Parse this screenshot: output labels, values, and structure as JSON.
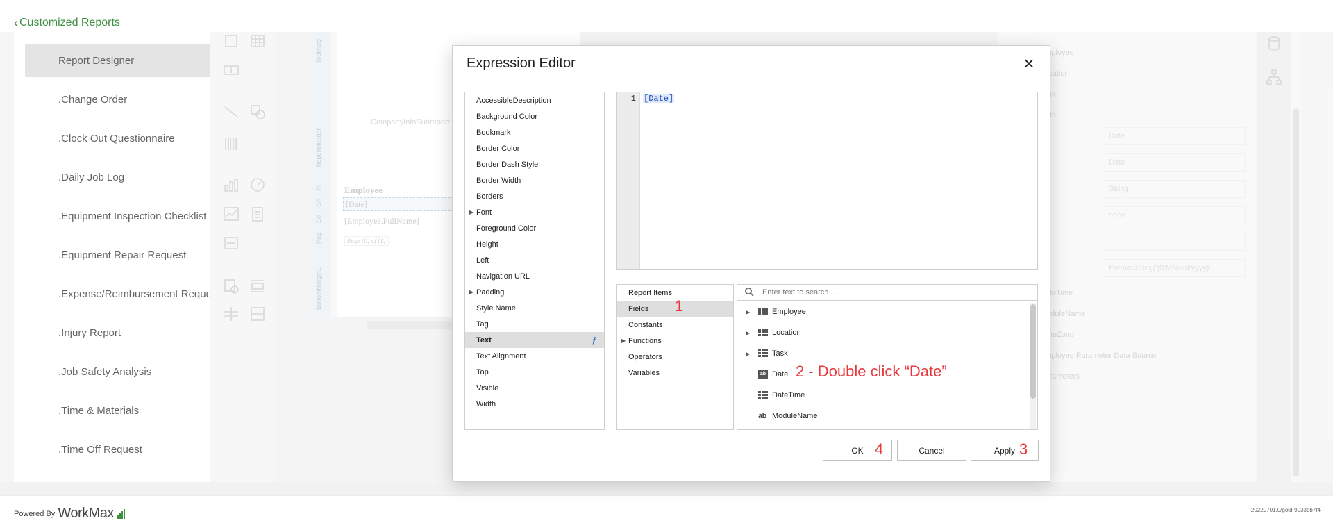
{
  "header": {
    "back_label": "Customized Reports"
  },
  "sidebar": {
    "items": [
      {
        "label": "Report Designer"
      },
      {
        "label": ".Change Order"
      },
      {
        "label": ".Clock Out Questionnaire"
      },
      {
        "label": ".Daily Job Log"
      },
      {
        "label": ".Equipment Inspection Checklist"
      },
      {
        "label": ".Equipment Repair Request"
      },
      {
        "label": ".Expense/Reimbursement Request"
      },
      {
        "label": ".Injury Report"
      },
      {
        "label": ".Job Safety Analysis"
      },
      {
        "label": ".Time & Materials"
      },
      {
        "label": ".Time Off Request"
      }
    ]
  },
  "canvas": {
    "band_labels": [
      "TopMarg",
      "ReportHeader",
      "Pi",
      "Gri",
      "De",
      "Pag",
      "BottomMargin1"
    ],
    "subreport_label": "CompanyInfoSubreport",
    "employee_label": "Employee",
    "date_field": "[Date]",
    "fullname_field": "[Employee.FullName]",
    "page_field": "Page {0} of {1}"
  },
  "properties_panel": {
    "rows": [
      "Employee",
      "Location",
      "Task",
      "Date",
      "DateTime",
      "ModuleName",
      "TimeZone",
      "Employee Parameter Data Source",
      "Parameters"
    ],
    "fields": [
      "Date",
      "Date",
      "String",
      "none",
      "",
      "FormatString('{0:MM/dd/yyyy}'..."
    ]
  },
  "dialog": {
    "title": "Expression Editor",
    "properties": [
      {
        "label": "AccessibleDescription"
      },
      {
        "label": "Background Color"
      },
      {
        "label": "Bookmark"
      },
      {
        "label": "Border Color"
      },
      {
        "label": "Border Dash Style"
      },
      {
        "label": "Border Width"
      },
      {
        "label": "Borders"
      },
      {
        "label": "Font",
        "expandable": true
      },
      {
        "label": "Foreground Color"
      },
      {
        "label": "Height"
      },
      {
        "label": "Left"
      },
      {
        "label": "Navigation URL"
      },
      {
        "label": "Padding",
        "expandable": true
      },
      {
        "label": "Style Name"
      },
      {
        "label": "Tag"
      },
      {
        "label": "Text",
        "selected": true,
        "badge": "f"
      },
      {
        "label": "Text Alignment"
      },
      {
        "label": "Top"
      },
      {
        "label": "Visible"
      },
      {
        "label": "Width"
      }
    ],
    "editor": {
      "line_number": "1",
      "code": "[Date]"
    },
    "categories": [
      {
        "label": "Report Items"
      },
      {
        "label": "Fields",
        "selected": true
      },
      {
        "label": "Constants"
      },
      {
        "label": "Functions",
        "expandable": true
      },
      {
        "label": "Operators"
      },
      {
        "label": "Variables"
      }
    ],
    "search": {
      "placeholder": "Enter text to search..."
    },
    "fields": [
      {
        "label": "Employee",
        "icon": "table-icon",
        "expandable": true
      },
      {
        "label": "Location",
        "icon": "table-icon",
        "expandable": true
      },
      {
        "label": "Task",
        "icon": "table-icon",
        "expandable": true
      },
      {
        "label": "Date",
        "icon": "date-icon",
        "expandable": false
      },
      {
        "label": "DateTime",
        "icon": "table-icon",
        "expandable": false
      },
      {
        "label": "ModuleName",
        "icon": "text-field-icon",
        "expandable": false
      }
    ],
    "buttons": {
      "ok": "OK",
      "cancel": "Cancel",
      "apply": "Apply"
    }
  },
  "annotations": {
    "step1": "1",
    "step2": "2 - Double click “Date”",
    "step3": "3",
    "step4": "4",
    "color": "#e8383d"
  },
  "footer": {
    "powered_by": "Powered By",
    "brand": "WorkMax",
    "version": "20220701.0/gold-9033db7f4"
  }
}
